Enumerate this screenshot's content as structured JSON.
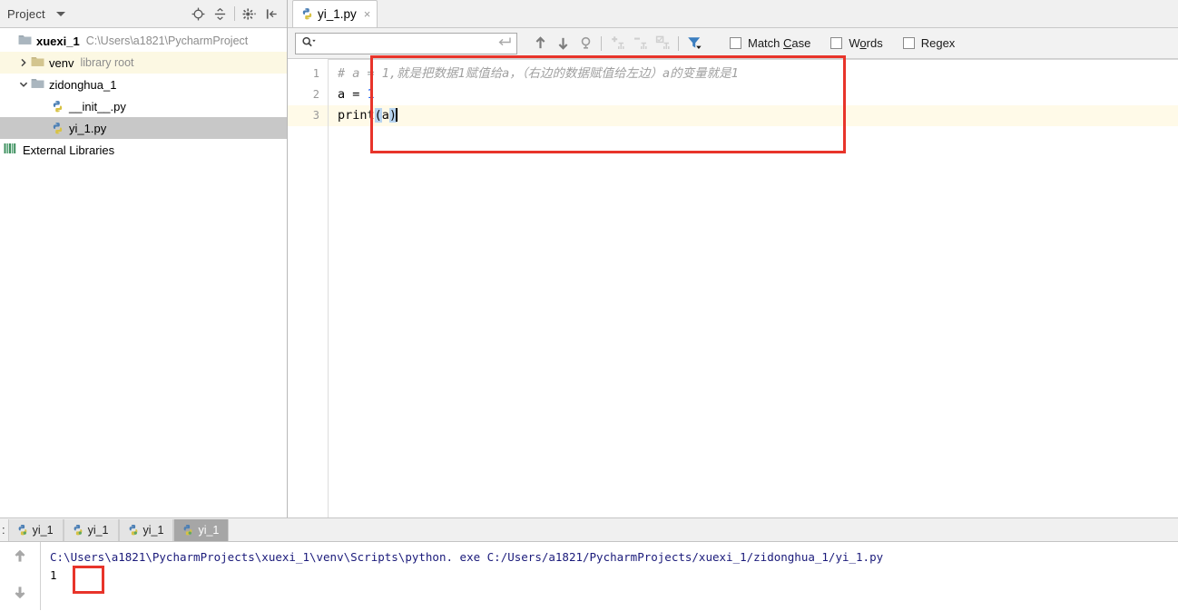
{
  "project_panel": {
    "title": "Project",
    "icons": [
      {
        "name": "locate-target-icon"
      },
      {
        "name": "collapse-all-icon"
      },
      {
        "name": "settings-gear-icon"
      },
      {
        "name": "hide-panel-icon"
      }
    ],
    "tree": [
      {
        "name": "xuexi_1",
        "path": "C:\\Users\\a1821\\PycharmProject",
        "icon": "folder-icon",
        "arrow": "none",
        "state": "normal",
        "indent": 1
      },
      {
        "name": "venv",
        "path": "library root",
        "icon": "folder-icon",
        "arrow": "collapsed",
        "state": "highlight-yellow",
        "indent": 2
      },
      {
        "name": "zidonghua_1",
        "path": "",
        "icon": "folder-icon",
        "arrow": "expanded",
        "state": "normal",
        "indent": 2
      },
      {
        "name": "__init__.py",
        "path": "",
        "icon": "python-file-icon",
        "arrow": "none",
        "state": "normal",
        "indent": 3
      },
      {
        "name": "yi_1.py",
        "path": "",
        "icon": "python-file-icon",
        "arrow": "none",
        "state": "selected",
        "indent": 3
      }
    ],
    "external_libraries": "External Libraries"
  },
  "editor": {
    "tab": {
      "label": "yi_1.py",
      "icon": "python-file-icon",
      "close": "×"
    },
    "find_bar": {
      "search_placeholder": "",
      "search_value": "",
      "search_icon": "magnifier-dropdown-icon",
      "enter_icon": "return-arrow-icon",
      "buttons": [
        {
          "name": "find-previous-icon"
        },
        {
          "name": "find-next-icon"
        },
        {
          "name": "find-in-selection-icon"
        },
        {
          "name": "add-column-icon"
        },
        {
          "name": "remove-column-icon"
        },
        {
          "name": "edit-column-icon"
        },
        {
          "name": "filter-icon"
        }
      ],
      "checkboxes": [
        {
          "label_pre": "Match ",
          "label_underline": "C",
          "label_post": "ase",
          "checked": false
        },
        {
          "label_pre": "W",
          "label_underline": "o",
          "label_post": "rds",
          "checked": false
        },
        {
          "label_pre": "Re",
          "label_underline": "g",
          "label_post": "ex",
          "checked": false
        }
      ]
    },
    "gutter_lines": [
      "1",
      "2",
      "3"
    ],
    "code": {
      "line1_comment": "# a = 1,就是把数据1赋值给a，（右边的数据赋值给左边）a的变量就是1",
      "line2_pre": "a = ",
      "line2_num": "1",
      "line3_fn": "print",
      "line3_open": "(",
      "line3_arg": "a",
      "line3_close": ")"
    }
  },
  "console": {
    "prefix": ":",
    "tabs": [
      {
        "label": "yi_1",
        "active": false
      },
      {
        "label": "yi_1",
        "active": false
      },
      {
        "label": "yi_1",
        "active": false
      },
      {
        "label": "yi_1",
        "active": true
      }
    ],
    "gutter_icons": [
      {
        "name": "scroll-up-icon"
      },
      {
        "name": "scroll-down-icon"
      }
    ],
    "command_line": "C:\\Users\\a1821\\PycharmProjects\\xuexi_1\\venv\\Scripts\\python. exe C:/Users/a1821/PycharmProjects/xuexi_1/zidonghua_1/yi_1.py",
    "result": "1"
  },
  "colors": {
    "annotation_red": "#e8342a",
    "current_line_yellow": "#fffae8",
    "selection_blue": "#b7d4f0",
    "number_blue": "#1750eb",
    "comment_gray": "#a0a0a0",
    "console_text_blue": "#1a1a7a"
  }
}
